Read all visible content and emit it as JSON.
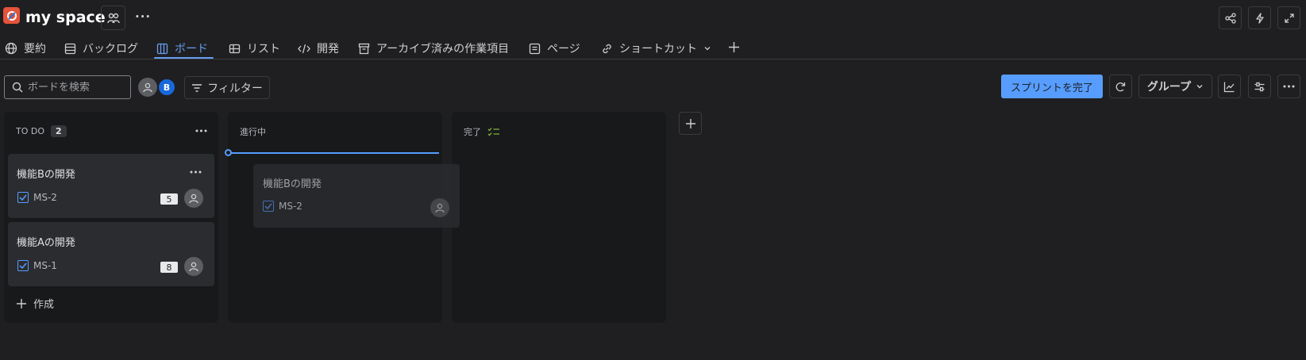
{
  "header": {
    "space_name": "my space",
    "more_label": "···"
  },
  "tabs": [
    {
      "label": "要約",
      "icon": "globe-icon"
    },
    {
      "label": "バックログ",
      "icon": "list-icon"
    },
    {
      "label": "ボード",
      "icon": "board-icon",
      "active": true
    },
    {
      "label": "リスト",
      "icon": "table-icon"
    },
    {
      "label": "開発",
      "icon": "code-icon"
    },
    {
      "label": "アーカイブ済みの作業項目",
      "icon": "archive-icon"
    },
    {
      "label": "ページ",
      "icon": "page-icon"
    },
    {
      "label": "ショートカット",
      "icon": "link-icon"
    }
  ],
  "toolbar": {
    "search_placeholder": "ボードを検索",
    "avatar_b": "B",
    "filter_label": "フィルター",
    "complete_sprint_label": "スプリントを完了",
    "group_label": "グループ"
  },
  "columns": [
    {
      "title": "TO DO",
      "count": "2"
    },
    {
      "title": "進行中"
    },
    {
      "title": "完了"
    }
  ],
  "cards": [
    {
      "title": "機能Bの開発",
      "key": "MS-2",
      "estimate": "5"
    },
    {
      "title": "機能Aの開発",
      "key": "MS-1",
      "estimate": "8"
    }
  ],
  "dragging_card": {
    "title": "機能Bの開発",
    "key": "MS-2"
  },
  "create_label": "作成",
  "colors": {
    "accent": "#579dff",
    "logo": "#e5533a",
    "done_check": "#82b536"
  }
}
